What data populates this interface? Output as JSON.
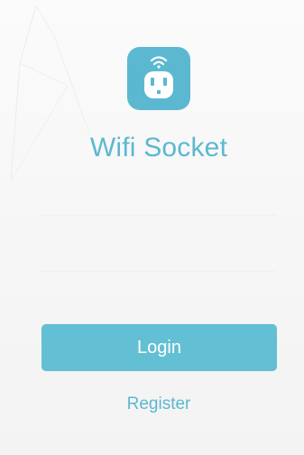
{
  "app": {
    "title": "Wifi Socket",
    "icon": "wifi-socket-icon",
    "accent_color": "#5cb8d0"
  },
  "actions": {
    "login_label": "Login",
    "register_label": "Register"
  }
}
